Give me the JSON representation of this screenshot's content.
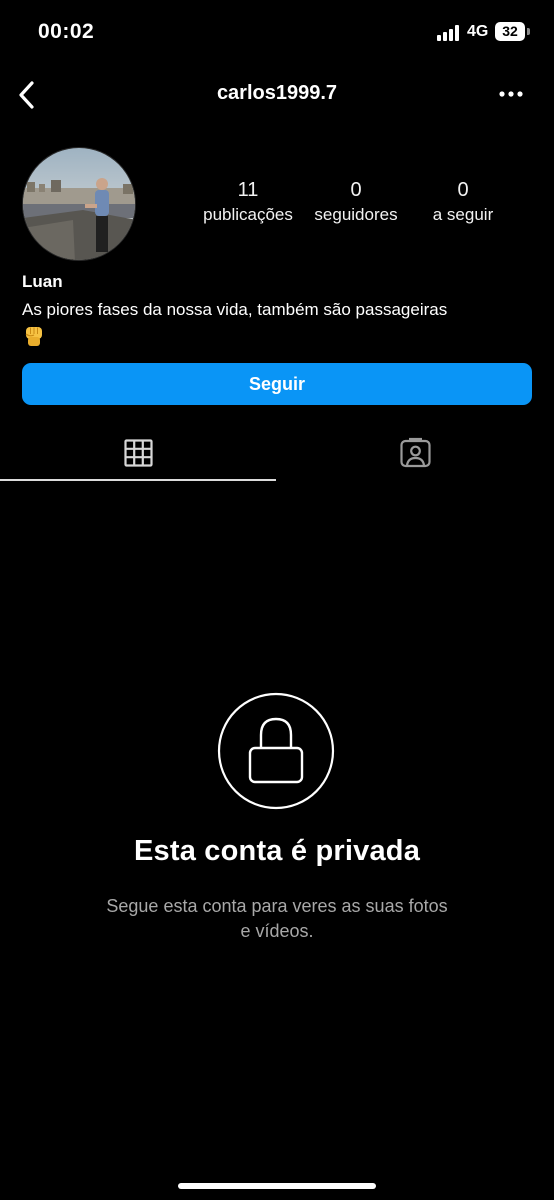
{
  "status_bar": {
    "time": "00:02",
    "network": "4G",
    "battery": "32"
  },
  "header": {
    "username": "carlos1999.7",
    "back_icon": "chevron-left-icon",
    "more_icon": "more-horizontal-icon"
  },
  "profile": {
    "stats": [
      {
        "value": "11",
        "label": "publicações"
      },
      {
        "value": "0",
        "label": "seguidores"
      },
      {
        "value": "0",
        "label": "a seguir"
      }
    ],
    "name": "Luan",
    "bio": "As piores fases da nossa vida, também são passageiras",
    "bio_emoji": "✊"
  },
  "actions": {
    "follow_label": "Seguir",
    "follow_color": "#0a95f6"
  },
  "tabs": [
    {
      "icon": "grid-icon",
      "selected": true
    },
    {
      "icon": "tagged-person-icon",
      "selected": false
    }
  ],
  "private_notice": {
    "title": "Esta conta é privada",
    "subtitle_line1": "Segue esta conta para veres as suas fotos",
    "subtitle_line2": "e vídeos.",
    "icon": "lock-icon"
  }
}
